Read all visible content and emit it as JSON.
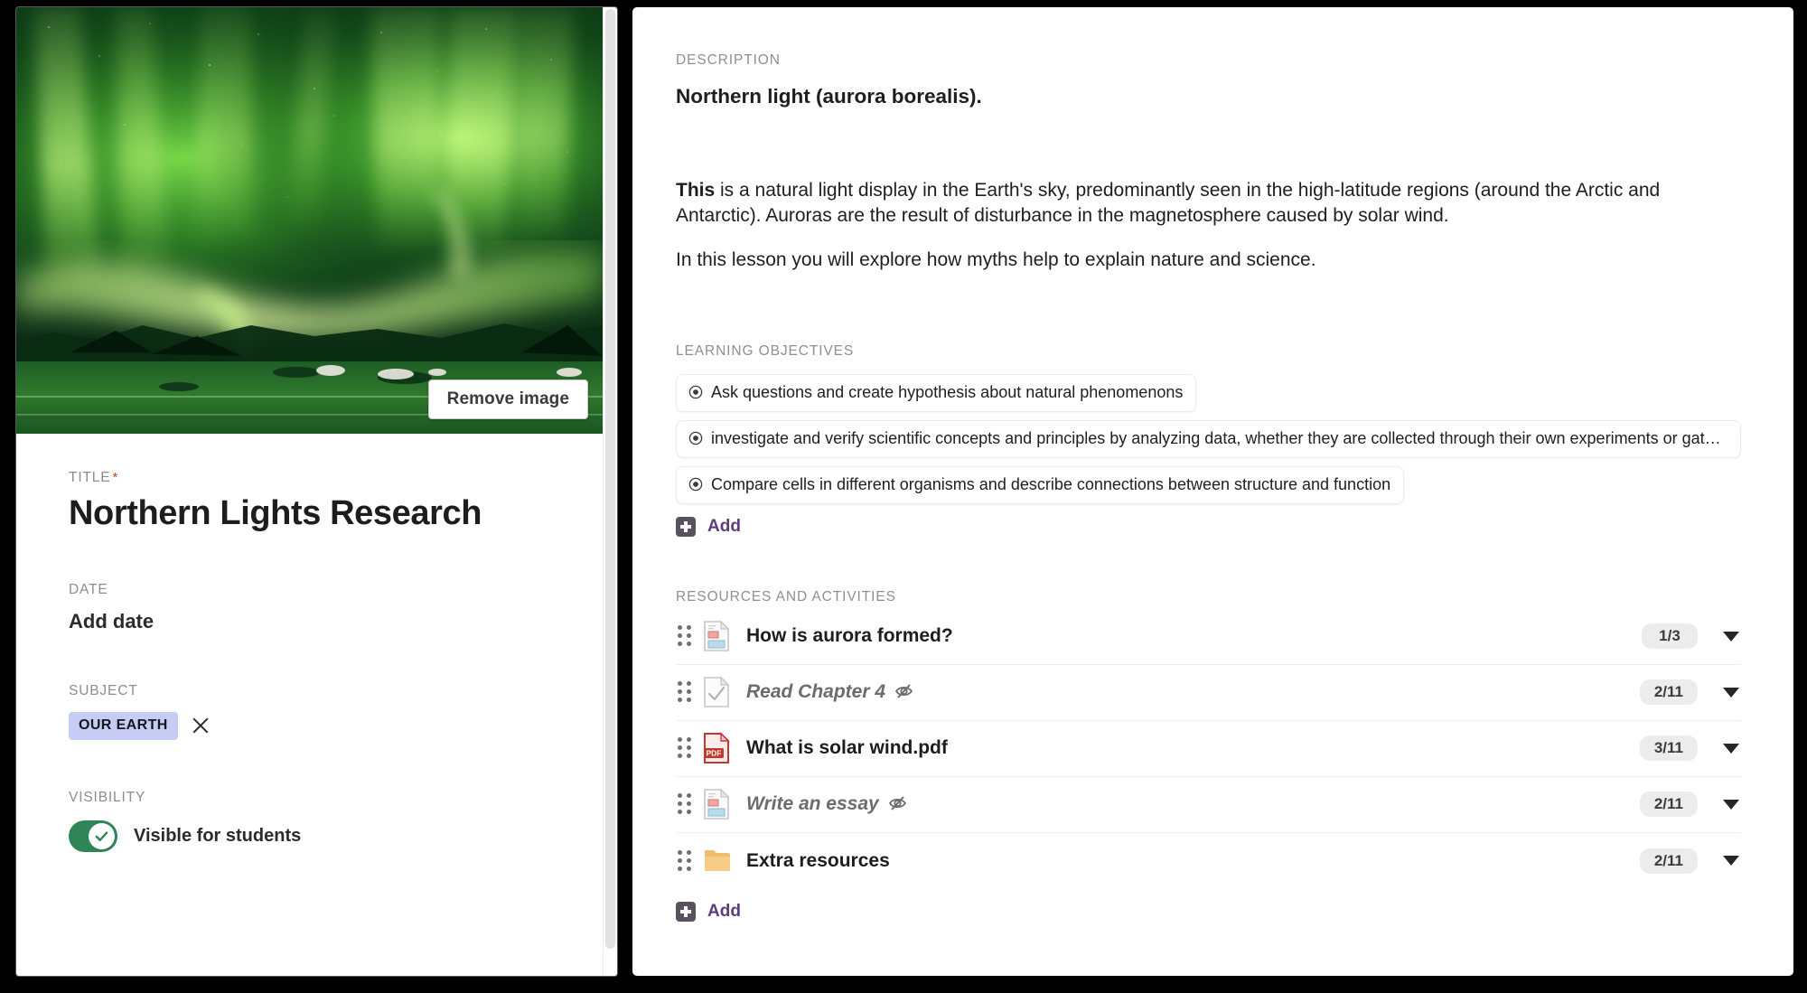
{
  "left_panel": {
    "hero": {
      "alt": "aurora-borealis-photo",
      "remove_button_label": "Remove image"
    },
    "title_field": {
      "label": "TITLE",
      "required_marker": "*",
      "value": "Northern Lights Research"
    },
    "date_field": {
      "label": "DATE",
      "value": "Add date"
    },
    "subject_field": {
      "label": "SUBJECT",
      "tag": "OUR EARTH"
    },
    "visibility_field": {
      "label": "VISIBILITY",
      "toggle_label": "Visible for students",
      "toggle_on": true,
      "toggle_color": "#2f8555"
    }
  },
  "right_panel": {
    "description": {
      "label": "DESCRIPTION",
      "heading": "Northern light (aurora borealis).",
      "paragraph_1_lead": "This",
      "paragraph_1_rest": " is a natural light display in the Earth's sky, predominantly seen in the high-latitude regions (around the Arctic and Antarctic). Auroras are the result of disturbance in the magnetosphere caused by solar wind.",
      "paragraph_2": "In this lesson you will explore how myths help to explain nature and science."
    },
    "learning_objectives": {
      "label": "LEARNING OBJECTIVES",
      "items": [
        {
          "text": "Ask questions and create hypothesis about natural phenomenons",
          "truncated": false
        },
        {
          "text": "investigate and verify scientific concepts and principles by analyzing data, whether they are collected through their own experiments or gathered from oth…",
          "truncated": true
        },
        {
          "text": "Compare cells in different organisms and describe connections between structure and function",
          "truncated": false
        }
      ],
      "add_label": "Add"
    },
    "resources": {
      "label": "RESOURCES AND ACTIVITIES",
      "items": [
        {
          "title": "How is aurora formed?",
          "icon": "document-icon",
          "hidden": false,
          "count": "1/3"
        },
        {
          "title": "Read Chapter 4",
          "icon": "task-check-icon",
          "hidden": true,
          "count": "2/11"
        },
        {
          "title": "What is solar wind.pdf",
          "icon": "pdf-icon",
          "hidden": false,
          "count": "3/11"
        },
        {
          "title": "Write an essay",
          "icon": "document-icon",
          "hidden": true,
          "count": "2/11"
        },
        {
          "title": "Extra resources",
          "icon": "folder-icon",
          "hidden": false,
          "count": "2/11"
        }
      ],
      "add_label": "Add"
    }
  },
  "colors": {
    "accent_purple": "#5c3d7e",
    "tag_background": "#c6ccf4",
    "toggle_green": "#2f8555",
    "pdf_red": "#c0392b",
    "folder_yellow": "#f1c376"
  }
}
